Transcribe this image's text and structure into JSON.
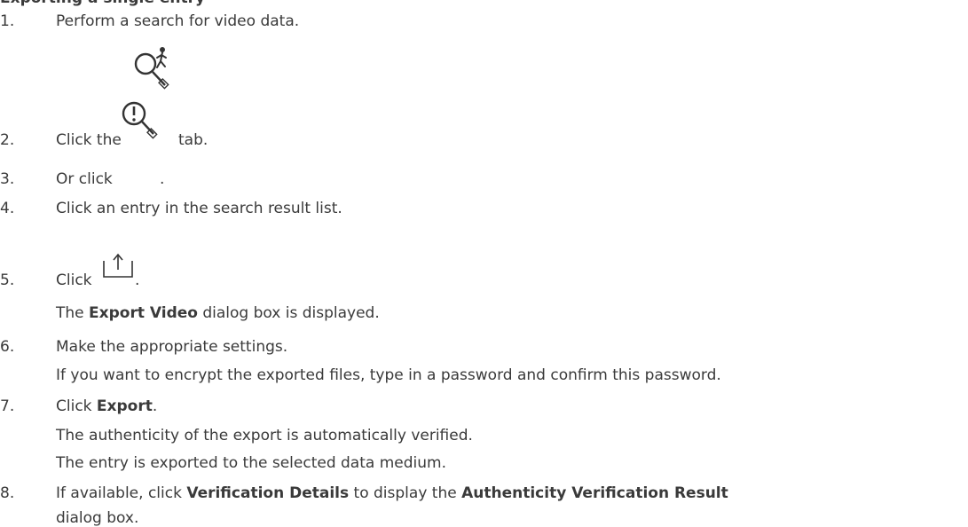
{
  "heading_fragment": "Exporting a single entry",
  "steps": [
    {
      "num": "1.",
      "text": "Perform a search for video data."
    },
    {
      "num": "2.",
      "pre": "Click the",
      "icon": "search-person-icon",
      "post": "tab."
    },
    {
      "num": "3.",
      "pre": "Or click",
      "icon": "search-alarm-icon",
      "post": "."
    },
    {
      "num": "4.",
      "text": "Click an entry in the search result list."
    },
    {
      "num": "5.",
      "pre": "Click",
      "icon": "export-icon",
      "post": ".",
      "sub": [
        {
          "pre": "The ",
          "bold": "Export Video",
          "post": " dialog box is displayed."
        }
      ]
    },
    {
      "num": "6.",
      "text": "Make the appropriate settings.",
      "sub": [
        {
          "text": "If you want to encrypt the exported files, type in a password and confirm this password."
        }
      ]
    },
    {
      "num": "7.",
      "pre": "Click ",
      "bold": "Export",
      "post": ".",
      "sub": [
        {
          "text": "The authenticity of the export is automatically verified."
        },
        {
          "text": "The entry is exported to the selected data medium."
        }
      ]
    },
    {
      "num": "8.",
      "pre": "If available, click ",
      "bold": "Verification Details",
      "mid": " to display the ",
      "bold2": "Authenticity Verification Result",
      "sub": [
        {
          "text": "dialog box."
        }
      ]
    }
  ]
}
